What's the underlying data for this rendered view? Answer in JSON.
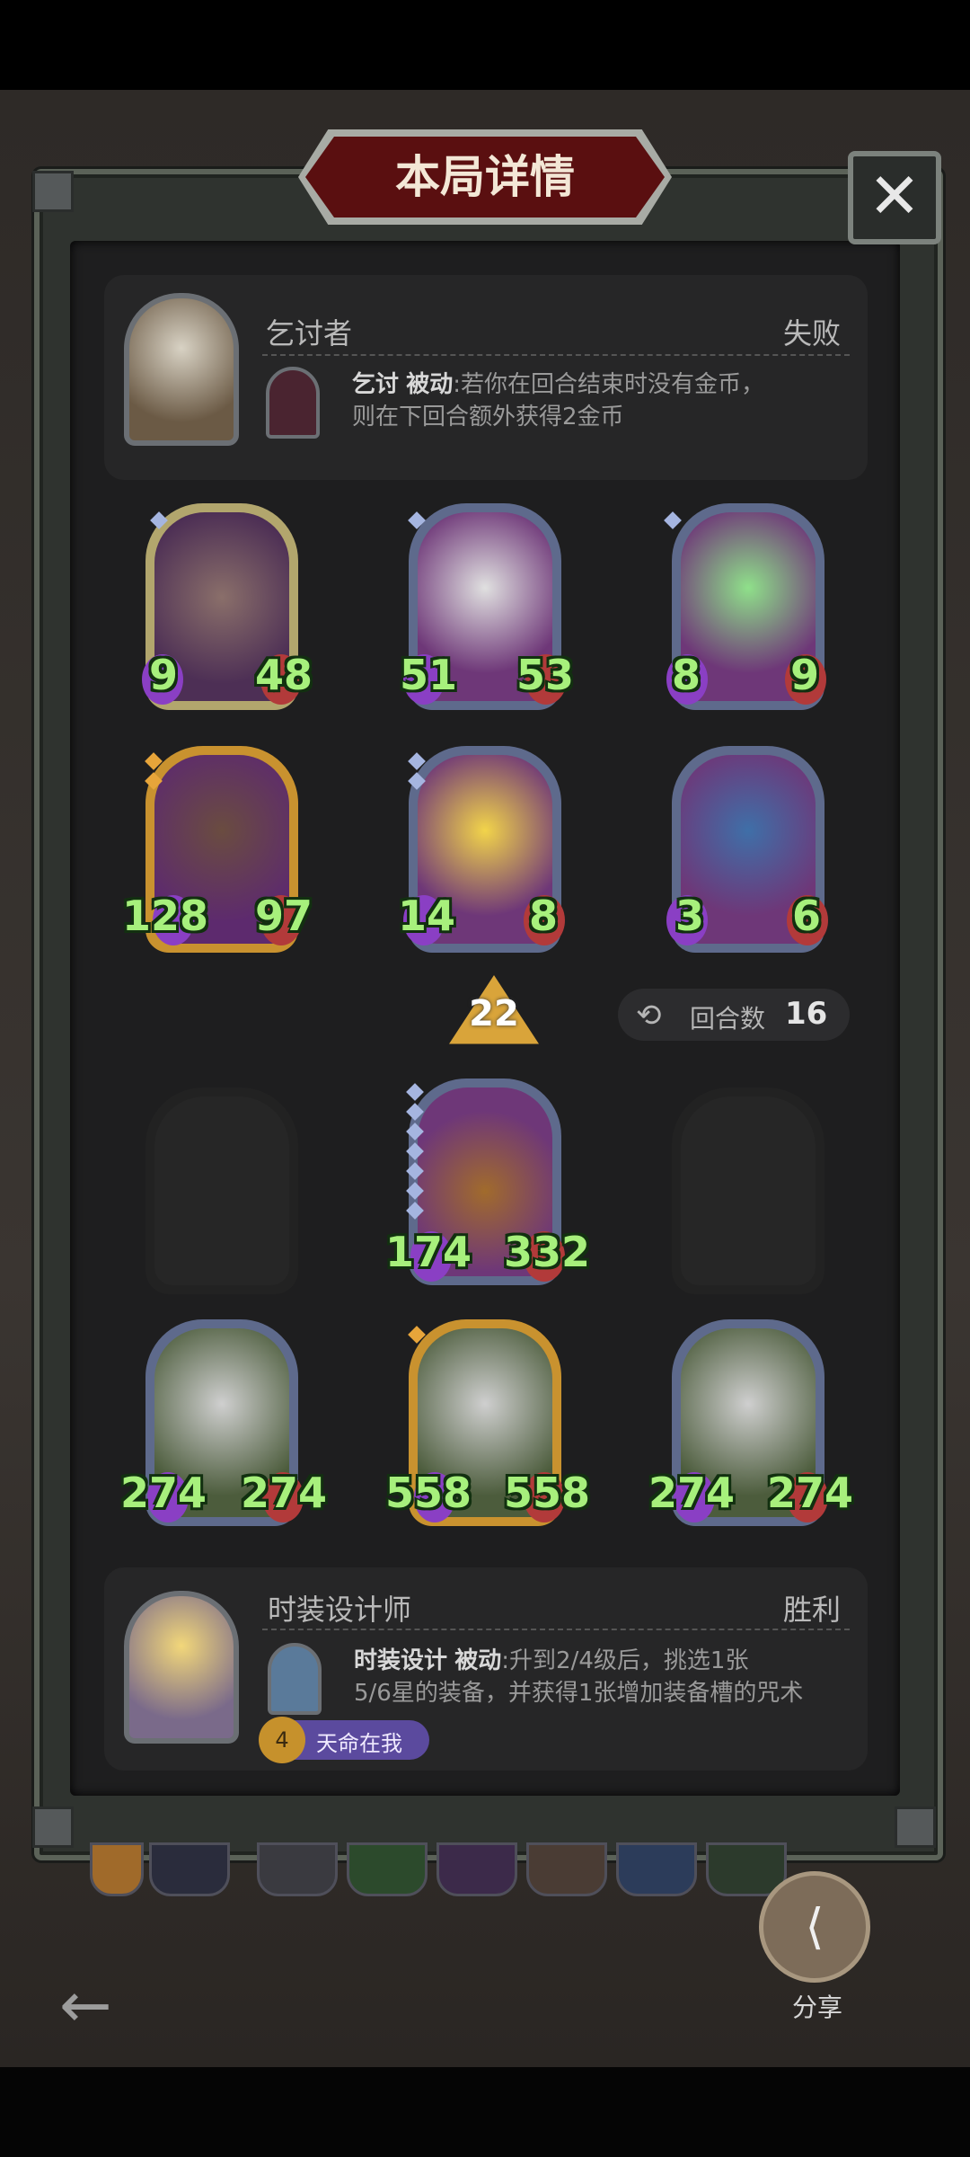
{
  "header": {
    "title": "本局详情",
    "close_icon": "✕"
  },
  "opponent": {
    "name": "乞讨者",
    "result": "失败",
    "skill_name": "乞讨",
    "skill_type": "被动",
    "skill_desc_1": ":若你在回合结束时没有金币，",
    "skill_desc_2": "则在下回合额外获得2金币"
  },
  "opponent_cards": [
    {
      "atk": "9",
      "hp": "48"
    },
    {
      "atk": "51",
      "hp": "53"
    },
    {
      "atk": "8",
      "hp": "9"
    },
    {
      "atk": "128",
      "hp": "97"
    },
    {
      "atk": "14",
      "hp": "8"
    },
    {
      "atk": "3",
      "hp": "6"
    }
  ],
  "center": {
    "rank": "22",
    "rounds_label": "回合数",
    "rounds_value": "16"
  },
  "player_hero_card": {
    "atk": "174",
    "hp": "332"
  },
  "player_cards": [
    {
      "atk": "274",
      "hp": "274"
    },
    {
      "atk": "558",
      "hp": "558"
    },
    {
      "atk": "274",
      "hp": "274"
    }
  ],
  "player": {
    "name": "时装设计师",
    "result": "胜利",
    "skill_name": "时装设计",
    "skill_type": "被动",
    "skill_desc_1": ":升到2/4级后，挑选1张",
    "skill_desc_2": "5/6星的装备，并获得1张增加装备槽的咒术",
    "buff_label": "天命在我",
    "buff_level": "4"
  },
  "footer": {
    "share_label": "分享",
    "share_icon": "share-icon",
    "back_icon": "←"
  }
}
